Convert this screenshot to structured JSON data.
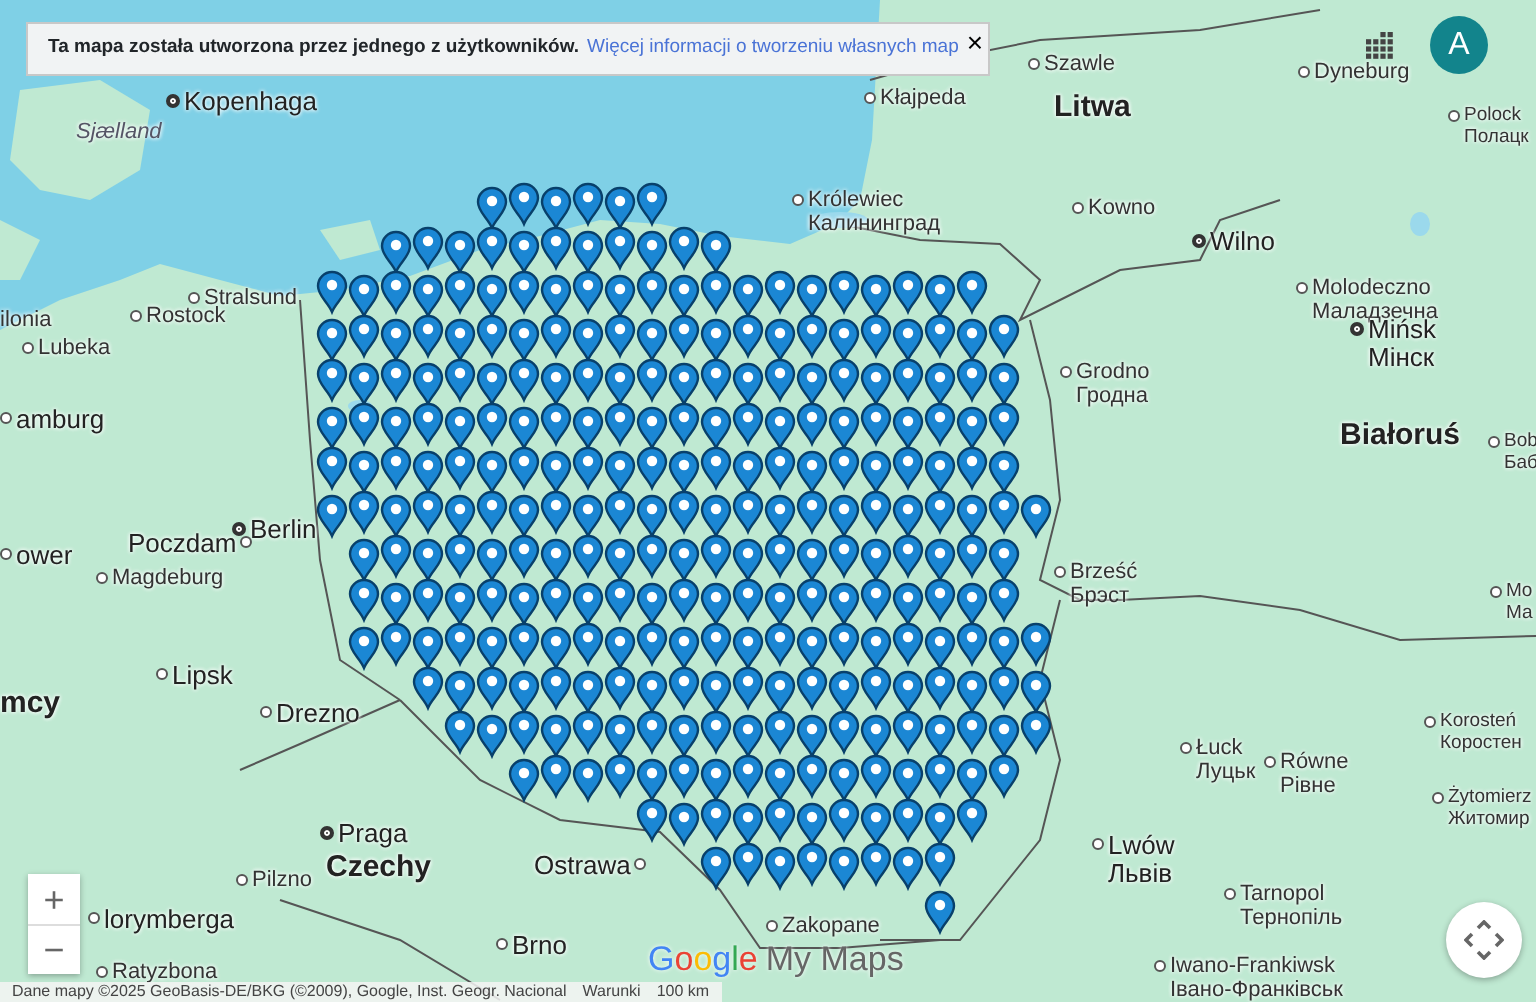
{
  "banner": {
    "text": "Ta mapa została utworzona przez jednego z użytkowników.",
    "link": "Więcej informacji o tworzeniu własnych map",
    "close": "×"
  },
  "account": {
    "initial": "A"
  },
  "labels": [
    {
      "text": "Kopenhaga",
      "kind": "capital"
    },
    {
      "text": "Sjælland",
      "kind": "region"
    },
    {
      "text": "Kłajpeda",
      "kind": "city"
    },
    {
      "text": "Szawle",
      "kind": "city"
    },
    {
      "text": "Litwa",
      "kind": "country"
    },
    {
      "text": "Dyneburg",
      "kind": "city"
    },
    {
      "text": "Polock",
      "sub": "Полацк",
      "kind": "small"
    },
    {
      "text": "Kowno",
      "kind": "city"
    },
    {
      "text": "Wilno",
      "kind": "capital"
    },
    {
      "text": "Królewiec",
      "sub": "Калининград",
      "kind": "city"
    },
    {
      "text": "ilonia",
      "kind": "plain"
    },
    {
      "text": "Stralsund",
      "kind": "city"
    },
    {
      "text": "Rostock",
      "kind": "city"
    },
    {
      "text": "Lubeka",
      "kind": "city"
    },
    {
      "text": "amburg",
      "kind": "bigcity"
    },
    {
      "text": "Molodeczno",
      "sub": "Маладзечна",
      "kind": "city"
    },
    {
      "text": "Mińsk",
      "sub": "Мінск",
      "kind": "capital"
    },
    {
      "text": "Grodno",
      "sub": "Гродна",
      "kind": "city"
    },
    {
      "text": "Białoruś",
      "kind": "country"
    },
    {
      "text": "Bob",
      "sub": "Баб",
      "kind": "small"
    },
    {
      "text": "Berlin",
      "kind": "capital"
    },
    {
      "text": "Poczdam",
      "kind": "cityright"
    },
    {
      "text": "ower",
      "kind": "bigcity"
    },
    {
      "text": "Magdeburg",
      "kind": "city"
    },
    {
      "text": "Brześć",
      "sub": "Брэст",
      "kind": "city"
    },
    {
      "text": "Mo",
      "sub": "Ма",
      "kind": "small"
    },
    {
      "text": "Lipsk",
      "kind": "bigcity"
    },
    {
      "text": "mcy",
      "kind": "country"
    },
    {
      "text": "Drezno",
      "kind": "bigcity"
    },
    {
      "text": "Korosteń",
      "sub": "Коростен",
      "kind": "small"
    },
    {
      "text": "Łuck",
      "sub": "Луцьк",
      "kind": "city"
    },
    {
      "text": "Równe",
      "sub": "Рівне",
      "kind": "city"
    },
    {
      "text": "Żytomierz",
      "sub": "Житомир",
      "kind": "small"
    },
    {
      "text": "Praga",
      "kind": "capital"
    },
    {
      "text": "Pilzno",
      "kind": "city"
    },
    {
      "text": "Czechy",
      "kind": "country"
    },
    {
      "text": "Ostrawa",
      "kind": "cityright"
    },
    {
      "text": "Lwów",
      "sub": "Львів",
      "kind": "bigcity"
    },
    {
      "text": "lorymberga",
      "kind": "bigcity"
    },
    {
      "text": "Tarnopol",
      "sub": "Тернопіль",
      "kind": "city"
    },
    {
      "text": "Brno",
      "kind": "bigcity"
    },
    {
      "text": "Zakopane",
      "kind": "city"
    },
    {
      "text": "Ratyzbona",
      "kind": "city"
    },
    {
      "text": "Iwano-Frankiwsk",
      "sub": "Івано-Франківськ",
      "kind": "city"
    }
  ],
  "zoom": {
    "in": "+",
    "out": "−"
  },
  "logo": {
    "brand": "Google",
    "product": "My Maps"
  },
  "attribution": {
    "text": "Dane mapy ©2025 GeoBasis-DE/BKG (©2009), Google, Inst. Geogr. Nacional",
    "terms": "Warunki",
    "scale": "100 km"
  }
}
